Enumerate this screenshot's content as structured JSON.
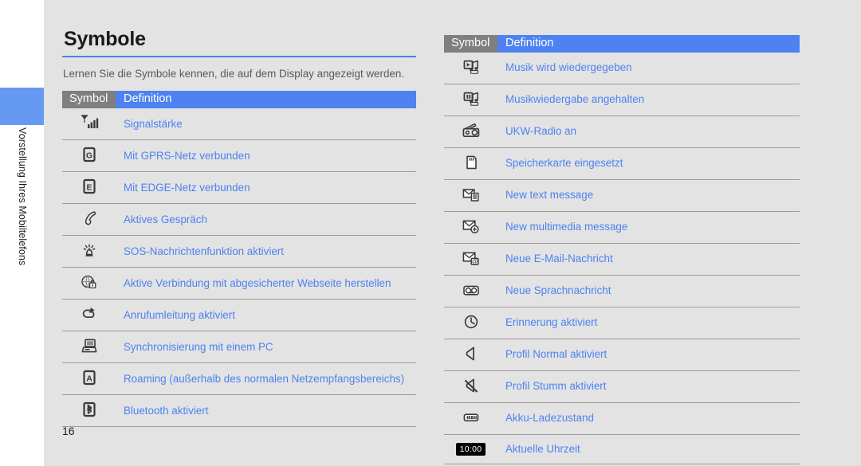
{
  "document": {
    "page_number": "16",
    "chapter_label": "Vorstellung Ihres Mobiltelefons",
    "title": "Symbole",
    "intro": "Lernen Sie die Symbole kennen, die auf dem Display angezeigt werden.",
    "colors": {
      "accent_blue": "#4d82f0",
      "tab_blue": "#6699f2",
      "header_gray": "#807f7f",
      "page_background": "#e3e3e3",
      "rule_color": "#9b9b9b",
      "body_text": "#57595b"
    }
  },
  "table_left": {
    "headers": {
      "symbol": "Symbol",
      "definition": "Definition"
    },
    "rows": [
      {
        "icon": "signal-strength-icon",
        "definition": "Signalstärke"
      },
      {
        "icon": "gprs-connected-icon",
        "definition": "Mit GPRS-Netz verbunden"
      },
      {
        "icon": "edge-connected-icon",
        "definition": "Mit EDGE-Netz verbunden"
      },
      {
        "icon": "active-call-icon",
        "definition": "Aktives Gespräch"
      },
      {
        "icon": "sos-message-icon",
        "definition": "SOS-Nachrichtenfunktion aktiviert"
      },
      {
        "icon": "secure-web-connection-icon",
        "definition": "Aktive Verbindung mit abgesicherter Webseite herstellen"
      },
      {
        "icon": "call-forwarding-icon",
        "definition": "Anrufumleitung aktiviert"
      },
      {
        "icon": "pc-sync-icon",
        "definition": "Synchronisierung mit einem PC"
      },
      {
        "icon": "roaming-icon",
        "definition": "Roaming (außerhalb des normalen Netzempfangsbereichs)"
      },
      {
        "icon": "bluetooth-icon",
        "definition": "Bluetooth aktiviert"
      }
    ]
  },
  "table_right": {
    "headers": {
      "symbol": "Symbol",
      "definition": "Definition"
    },
    "rows": [
      {
        "icon": "music-playing-icon",
        "definition": "Musik wird wiedergegeben"
      },
      {
        "icon": "music-paused-icon",
        "definition": "Musikwiedergabe angehalten"
      },
      {
        "icon": "fm-radio-icon",
        "definition": "UKW-Radio an"
      },
      {
        "icon": "memory-card-icon",
        "definition": "Speicherkarte eingesetzt"
      },
      {
        "icon": "new-text-message-icon",
        "definition": "New text message"
      },
      {
        "icon": "new-mms-icon",
        "definition": "New multimedia message"
      },
      {
        "icon": "new-email-icon",
        "definition": "Neue E-Mail-Nachricht"
      },
      {
        "icon": "new-voicemail-icon",
        "definition": "Neue Sprachnachricht"
      },
      {
        "icon": "alarm-reminder-icon",
        "definition": "Erinnerung aktiviert"
      },
      {
        "icon": "profile-normal-icon",
        "definition": "Profil Normal aktiviert"
      },
      {
        "icon": "profile-silent-icon",
        "definition": "Profil Stumm aktiviert"
      },
      {
        "icon": "battery-level-icon",
        "definition": "Akku-Ladezustand"
      },
      {
        "icon": "current-time-icon",
        "definition": "Aktuelle Uhrzeit",
        "icon_text": "10:00"
      }
    ]
  }
}
